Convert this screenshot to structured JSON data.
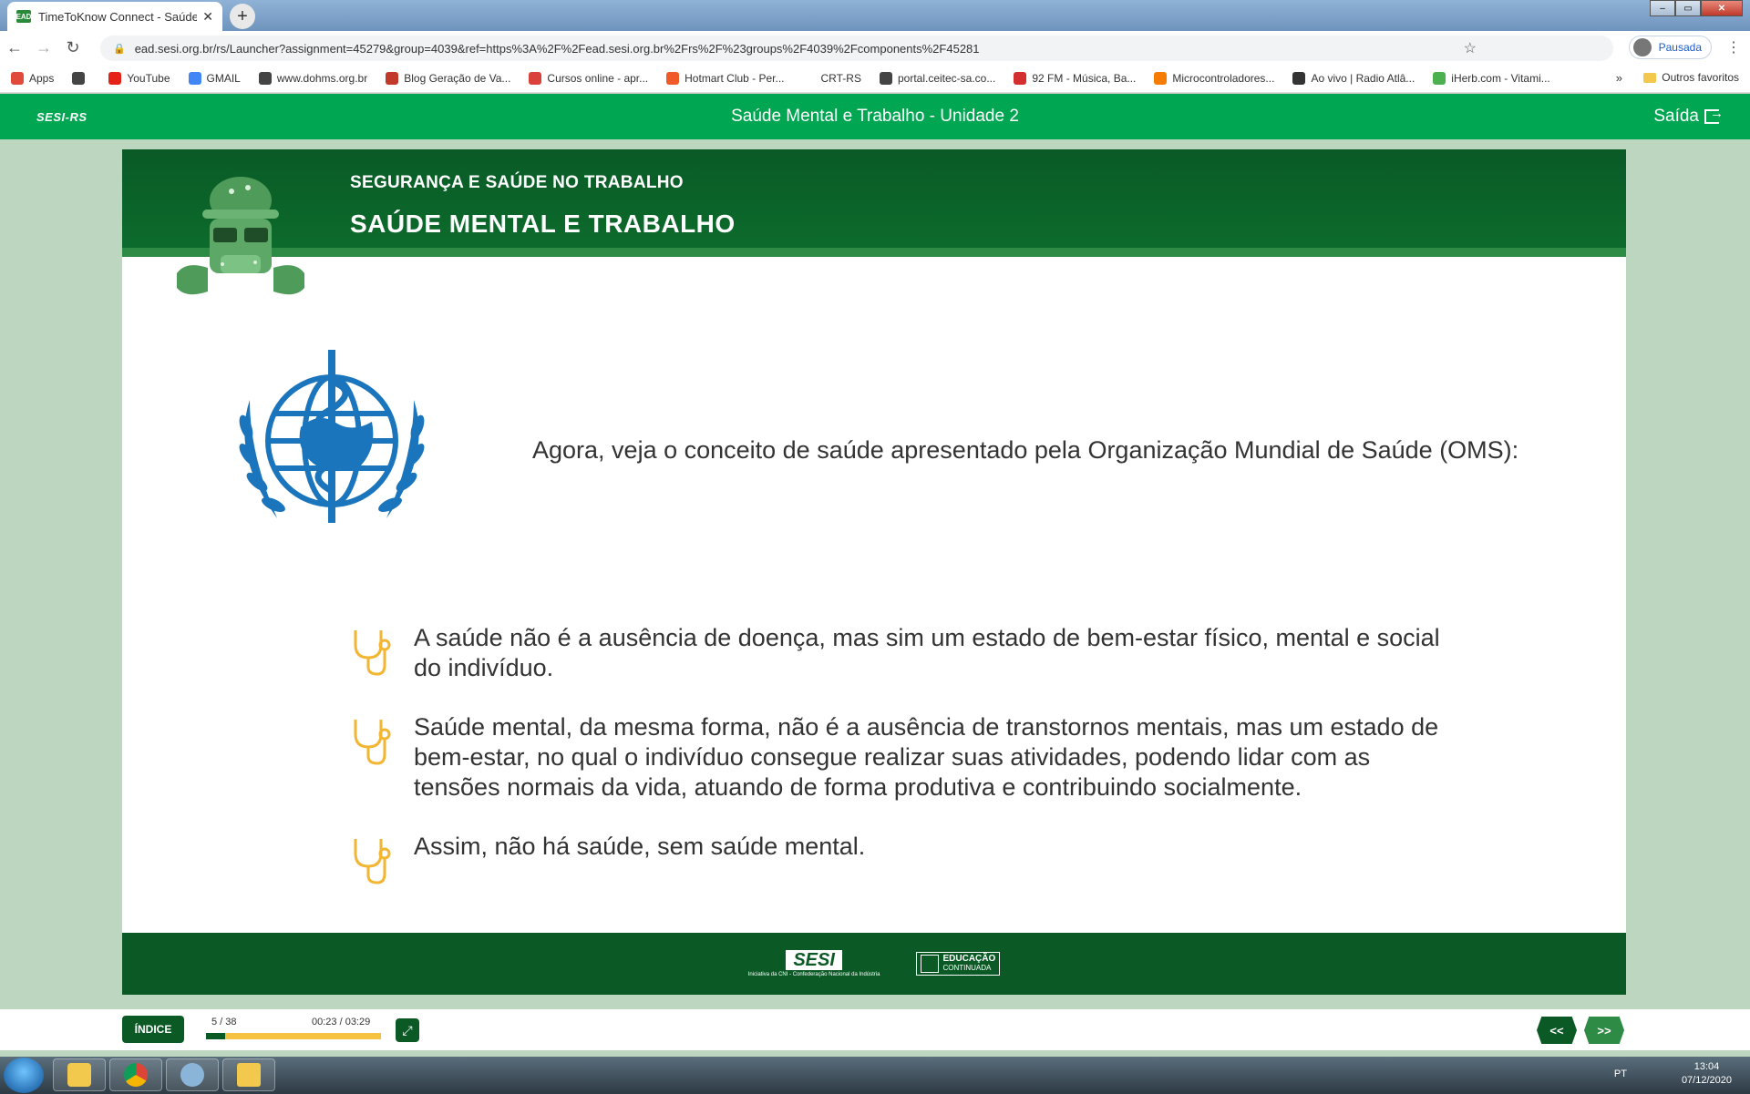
{
  "browser": {
    "tab_title": "TimeToKnow Connect - Saúde M",
    "tab_favicon_text": "EAD",
    "url": "ead.sesi.org.br/rs/Launcher?assignment=45279&group=4039&ref=https%3A%2F%2Fead.sesi.org.br%2Frs%2F%23groups%2F4039%2Fcomponents%2F45281",
    "profile_label": "Pausada",
    "bookmarks": [
      {
        "label": "Apps",
        "color": "#e04a3a"
      },
      {
        "label": "",
        "color": "#444444"
      },
      {
        "label": "YouTube",
        "color": "#e62117"
      },
      {
        "label": "GMAIL",
        "color": "#4285f4"
      },
      {
        "label": "www.dohms.org.br",
        "color": "#444444"
      },
      {
        "label": "Blog Geração de Va...",
        "color": "#c0392b"
      },
      {
        "label": "Cursos online - apr...",
        "color": "#d9413a"
      },
      {
        "label": "Hotmart Club - Per...",
        "color": "#f05a28"
      },
      {
        "label": "CRT-RS",
        "color": "#ffffff"
      },
      {
        "label": "portal.ceitec-sa.co...",
        "color": "#444444"
      },
      {
        "label": "92 FM - Música, Ba...",
        "color": "#d32f2f"
      },
      {
        "label": "Microcontroladores...",
        "color": "#f57c00"
      },
      {
        "label": "Ao vivo | Radio Atlâ...",
        "color": "#333333"
      },
      {
        "label": "iHerb.com - Vitami...",
        "color": "#4caf50"
      }
    ],
    "bookmarks_more": "»",
    "other_bookmarks": "Outros favoritos"
  },
  "app": {
    "brand": "SESI-RS",
    "title": "Saúde Mental e Trabalho - Unidade 2",
    "exit_label": "Saída"
  },
  "course": {
    "kicker": "SEGURANÇA E SAÚDE NO TRABALHO",
    "title": "SAÚDE MENTAL E TRABALHO",
    "intro": "Agora, veja o conceito de saúde apresentado pela Organização Mundial de Saúde (OMS):",
    "bullets": [
      "A saúde não é a ausência de doença, mas sim um estado de bem-estar físico, mental e social do indivíduo.",
      "Saúde mental, da mesma forma, não é a ausência de transtornos mentais, mas um estado de bem-estar, no qual o indivíduo consegue realizar suas atividades, podendo lidar com as tensões normais da vida, atuando de forma produtiva e contribuindo socialmente.",
      "Assim, não há saúde, sem saúde mental."
    ],
    "footer_logo_sesi": "SESI",
    "footer_logo_sesi_sub": "Iniciativa da CNI - Confederação Nacional da Indústria",
    "footer_logo_edu_line1": "EDUCAÇÃO",
    "footer_logo_edu_line2": "CONTINUADA",
    "accent_green": "#0b5a26",
    "bright_green": "#00a651",
    "icon_color": "#f2b632"
  },
  "player": {
    "index_label": "ÍNDICE",
    "page": "5 / 38",
    "time": "00:23 / 03:29",
    "progress_fraction": 0.11,
    "prev_label": "<<",
    "next_label": ">>"
  },
  "taskbar": {
    "lang": "PT",
    "time": "13:04",
    "date": "07/12/2020"
  }
}
